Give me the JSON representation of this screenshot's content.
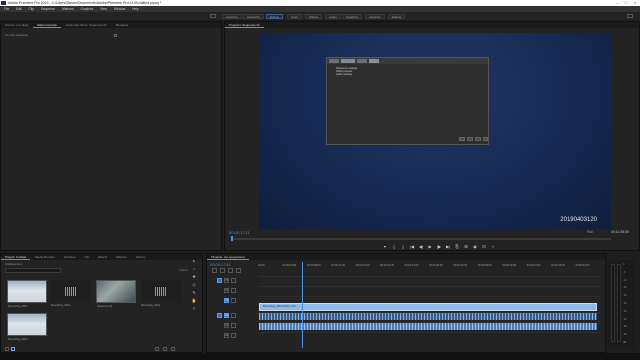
{
  "window": {
    "title": "Adobe Premiere Pro 2019 - C:\\Users\\Steven\\Documents\\Adobe\\Premiere Pro\\13.0\\Untitled.prproj *",
    "controls": [
      "–",
      "□",
      "×"
    ]
  },
  "menu": [
    "File",
    "Edit",
    "Clip",
    "Sequence",
    "Markers",
    "Graphics",
    "View",
    "Window",
    "Help"
  ],
  "workspaces": [
    {
      "label": "Learning",
      "active": false
    },
    {
      "label": "Assembly",
      "active": false
    },
    {
      "label": "Editing",
      "active": true
    },
    {
      "label": "Color",
      "active": false
    },
    {
      "label": "Effects",
      "active": false
    },
    {
      "label": "Audio",
      "active": false
    },
    {
      "label": "Graphics",
      "active": false
    },
    {
      "label": "Libraries",
      "active": false
    },
    {
      "label": "Editing",
      "active": false
    }
  ],
  "source_panel": {
    "tabs": [
      "Source: (no clips)",
      "Effect Controls",
      "Audio Clip Mixer: Sequence 01",
      "Metadata"
    ],
    "active_tab": 1,
    "content_label": "(no clip selected)"
  },
  "program_monitor": {
    "tab": "Program: Sequence 01",
    "timecode": "00;00;17;11",
    "fit": "Full",
    "duration": "00;11;38;05",
    "stamp": "20190403120",
    "inner_window": {
      "lines": [
        "Sequence settings",
        "Video preview",
        "Audio settings"
      ]
    },
    "transport": [
      "▾",
      "{",
      "}",
      "|◀",
      "◀|",
      "▶",
      "|▶",
      "▶|",
      "⎘",
      "⊞",
      "◉",
      "⊡",
      "+"
    ]
  },
  "project_panel": {
    "tabs": [
      "Project: Untitled",
      "Media Browser",
      "Libraries",
      "Info",
      "Effects",
      "Markers",
      "History"
    ],
    "project_file": "Untitled.prproj",
    "item_count": "4 Items",
    "items": [
      {
        "name": "Recording_2019...",
        "duration": "11;38;05",
        "type": "video"
      },
      {
        "name": "Recording_2019...",
        "duration": "",
        "type": "audio"
      },
      {
        "name": "Sequence 01",
        "duration": "11;38;05",
        "type": "sequence"
      },
      {
        "name": "Recording_2019...",
        "duration": "",
        "type": "audio"
      },
      {
        "name": "Recording_2019...",
        "duration": "11;38;05",
        "type": "video"
      }
    ]
  },
  "timeline": {
    "tab": "Timeline: (no sequences)",
    "sequence_tab": "Sequence 01",
    "timecode": "00;00;17;11",
    "ruler": [
      "00;00",
      "00;00;04;00",
      "00;00;08;00",
      "00;00;12;00",
      "00;00;16;00",
      "00;00;20;00",
      "00;00;24;00",
      "00;00;28;00",
      "00;00;32;00",
      "00;00;36;00",
      "00;00;40;00",
      "00;00;44;00",
      "00;00;48;00",
      "00;00;52;00"
    ],
    "tracks": [
      "V3",
      "V2",
      "V1",
      "A1",
      "A2",
      "A3"
    ],
    "video_clip": "Recording_2019-04-03_120...",
    "meter_scale": [
      "0",
      "-6",
      "-12",
      "-18",
      "-24",
      "-30",
      "-36",
      "-42",
      "-48",
      "-54",
      "dB"
    ]
  },
  "tools": [
    "▸",
    "⇔",
    "✥",
    "◇",
    "✎",
    "✋",
    "T"
  ]
}
